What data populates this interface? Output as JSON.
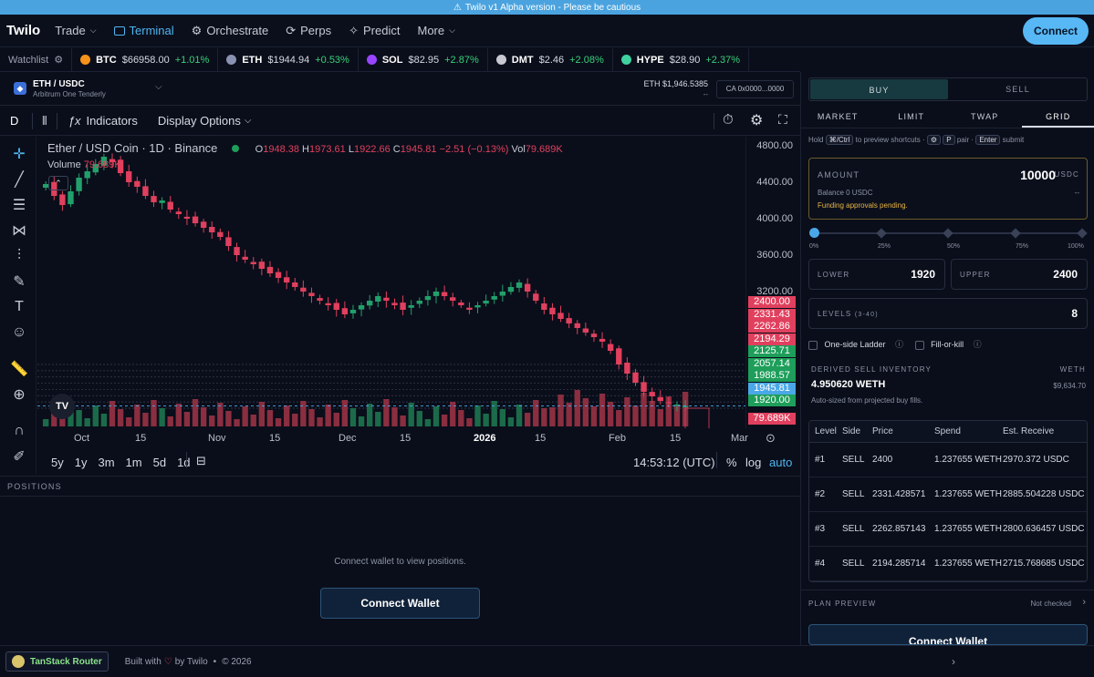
{
  "banner": {
    "text": "Twilo v1 Alpha version - Please be cautious"
  },
  "nav": {
    "logo": "Twilo",
    "items": [
      {
        "label": "Trade",
        "icon": "chevron-down-icon"
      },
      {
        "label": "Terminal",
        "icon": "terminal-icon"
      },
      {
        "label": "Orchestrate",
        "icon": "robot-icon"
      },
      {
        "label": "Perps",
        "icon": "perps-icon"
      },
      {
        "label": "Predict",
        "icon": "sparkle-icon"
      },
      {
        "label": "More",
        "icon": "chevron-down-icon"
      }
    ],
    "connect_label": "Connect"
  },
  "ticker": {
    "watchlist_label": "Watchlist",
    "items": [
      {
        "symbol": "BTC",
        "price": "$66958.00",
        "change": "+1.01%",
        "color": "#f7931a"
      },
      {
        "symbol": "ETH",
        "price": "$1944.94",
        "change": "+0.53%",
        "color": "#8a92b2"
      },
      {
        "symbol": "SOL",
        "price": "$82.95",
        "change": "+2.87%",
        "color": "#9945ff"
      },
      {
        "symbol": "DMT",
        "price": "$2.46",
        "change": "+2.08%",
        "color": "#c8c8d0"
      },
      {
        "symbol": "HYPE",
        "price": "$28.90",
        "change": "+2.37%",
        "color": "#3fd1a0"
      }
    ]
  },
  "pair": {
    "name": "ETH / USDC",
    "network": "Arbitrum One Tenderly",
    "price_label": "ETH $1,946.5385",
    "price_sub": "--",
    "ca": "CA 0x0000...0000"
  },
  "toolbar": {
    "interval": "D",
    "indicators": "Indicators",
    "display_options": "Display Options"
  },
  "legend": {
    "title": "Ether / USD Coin · 1D · Binance",
    "o_label": "O",
    "o_value": "1948.38",
    "h_label": "H",
    "h_value": "1973.61",
    "l_label": "L",
    "l_value": "1922.66",
    "c_label": "C",
    "c_value": "1945.81",
    "change": "−2.51 (−0.13%)",
    "vol_label": "Vol",
    "vol_value": "79.689K",
    "volume_label": "Volume",
    "volume_value": "79.689K"
  },
  "chart_data": {
    "type": "candlestick",
    "title": "Ether / USD Coin · 1D · Binance",
    "ylim": [
      1700,
      4900
    ],
    "y_ticks": [
      4800,
      4400,
      4000,
      3600,
      3200
    ],
    "x_ticks": [
      "Oct",
      "15",
      "Nov",
      "15",
      "Dec",
      "15",
      "2026",
      "15",
      "Feb",
      "15",
      "Mar"
    ],
    "close_series": [
      4380,
      4250,
      4150,
      4300,
      4450,
      4520,
      4600,
      4680,
      4620,
      4500,
      4400,
      4350,
      4250,
      4180,
      4200,
      4100,
      4050,
      4000,
      3950,
      3900,
      3850,
      3800,
      3700,
      3600,
      3550,
      3500,
      3450,
      3400,
      3350,
      3300,
      3250,
      3200,
      3150,
      3100,
      3050,
      3000,
      2950,
      3000,
      3050,
      3100,
      3150,
      3100,
      3050,
      3000,
      3050,
      3100,
      3150,
      3200,
      3150,
      3100,
      3050,
      3000,
      3050,
      3100,
      3150,
      3200,
      3250,
      3300,
      3200,
      3100,
      3000,
      2950,
      2900,
      2850,
      2800,
      2750,
      2700,
      2650,
      2550,
      2400,
      2300,
      2200,
      2100,
      2050,
      2000,
      1980,
      1960,
      1945
    ],
    "volume": "79.689K",
    "grid_levels": [
      2400.0,
      2331.43,
      2262.86,
      2194.29,
      2125.71,
      2057.14,
      1988.57,
      1920.0
    ],
    "last_price": 1945.81
  },
  "yaxis": {
    "labels": [
      "4800.00",
      "4400.00",
      "4000.00",
      "3600.00",
      "3200.00"
    ],
    "tags": [
      {
        "text": "2400.00",
        "color": "#e0405e"
      },
      {
        "text": "2331.43",
        "color": "#e0405e"
      },
      {
        "text": "2262.86",
        "color": "#e0405e"
      },
      {
        "text": "2194.29",
        "color": "#e0405e"
      },
      {
        "text": "2125.71",
        "color": "#1e9e5a"
      },
      {
        "text": "2057.14",
        "color": "#1e9e5a"
      },
      {
        "text": "1988.57",
        "color": "#1e9e5a"
      },
      {
        "text": "1945.81",
        "color": "#4aa8e8"
      },
      {
        "text": "1920.00",
        "color": "#1e9e5a"
      }
    ],
    "vol_tag": "79.689K"
  },
  "xaxis": {
    "labels": [
      "Oct",
      "15",
      "Nov",
      "15",
      "Dec",
      "15",
      "2026",
      "15",
      "Feb",
      "15",
      "Mar"
    ]
  },
  "ranges": {
    "items": [
      "5y",
      "1y",
      "3m",
      "1m",
      "5d",
      "1d"
    ],
    "time": "14:53:12 (UTC)",
    "pct": "%",
    "log": "log",
    "auto": "auto"
  },
  "positions": {
    "header": "POSITIONS",
    "empty": "Connect wallet to view positions.",
    "button": "Connect Wallet"
  },
  "footer": {
    "router": "TanStack Router",
    "built": "Built with",
    "by": "by Twilo",
    "dot": "•",
    "year": "© 2026"
  },
  "order": {
    "buy": "BUY",
    "sell": "SELL",
    "tabs": [
      "MARKET",
      "LIMIT",
      "TWAP",
      "GRID"
    ],
    "hint_hold": "Hold",
    "hint_key": "⌘/Ctrl",
    "hint_preview": "to preview shortcuts ·",
    "hint_p": "P",
    "hint_pair": "pair ·",
    "hint_enter": "Enter",
    "hint_submit": "submit",
    "amount_label": "AMOUNT",
    "amount_value": "10000",
    "amount_unit": "USDC",
    "balance": "Balance 0 USDC",
    "balance_right": "--",
    "funding": "Funding approvals pending.",
    "slider_pct": 0,
    "slider_labels": [
      "0%",
      "25%",
      "50%",
      "75%",
      "100%"
    ],
    "lower_label": "LOWER",
    "lower_value": "1920",
    "upper_label": "UPPER",
    "upper_value": "2400",
    "levels_label": "LEVELS",
    "levels_range": "(3-40)",
    "levels_value": "8",
    "one_side": "One-side Ladder",
    "fok": "Fill-or-kill",
    "derived_label": "DERIVED SELL INVENTORY",
    "derived_unit": "WETH",
    "derived_value": "4.950620 WETH",
    "derived_usd": "$9,634.70",
    "derived_note": "Auto-sized from projected buy fills.",
    "table_headers": [
      "Level",
      "Side",
      "Price",
      "Spend",
      "Est. Receive"
    ],
    "rows": [
      {
        "level": "#1",
        "side": "SELL",
        "price": "2400",
        "spend": "1.237655 WETH",
        "receive": "2970.372 USDC"
      },
      {
        "level": "#2",
        "side": "SELL",
        "price": "2331.428571",
        "spend": "1.237655 WETH",
        "receive": "2885.504228 USDC"
      },
      {
        "level": "#3",
        "side": "SELL",
        "price": "2262.857143",
        "spend": "1.237655 WETH",
        "receive": "2800.636457 USDC"
      },
      {
        "level": "#4",
        "side": "SELL",
        "price": "2194.285714",
        "spend": "1.237655 WETH",
        "receive": "2715.768685 USDC"
      }
    ],
    "plan_label": "PLAN PREVIEW",
    "plan_status": "Not checked",
    "connect": "Connect Wallet"
  }
}
